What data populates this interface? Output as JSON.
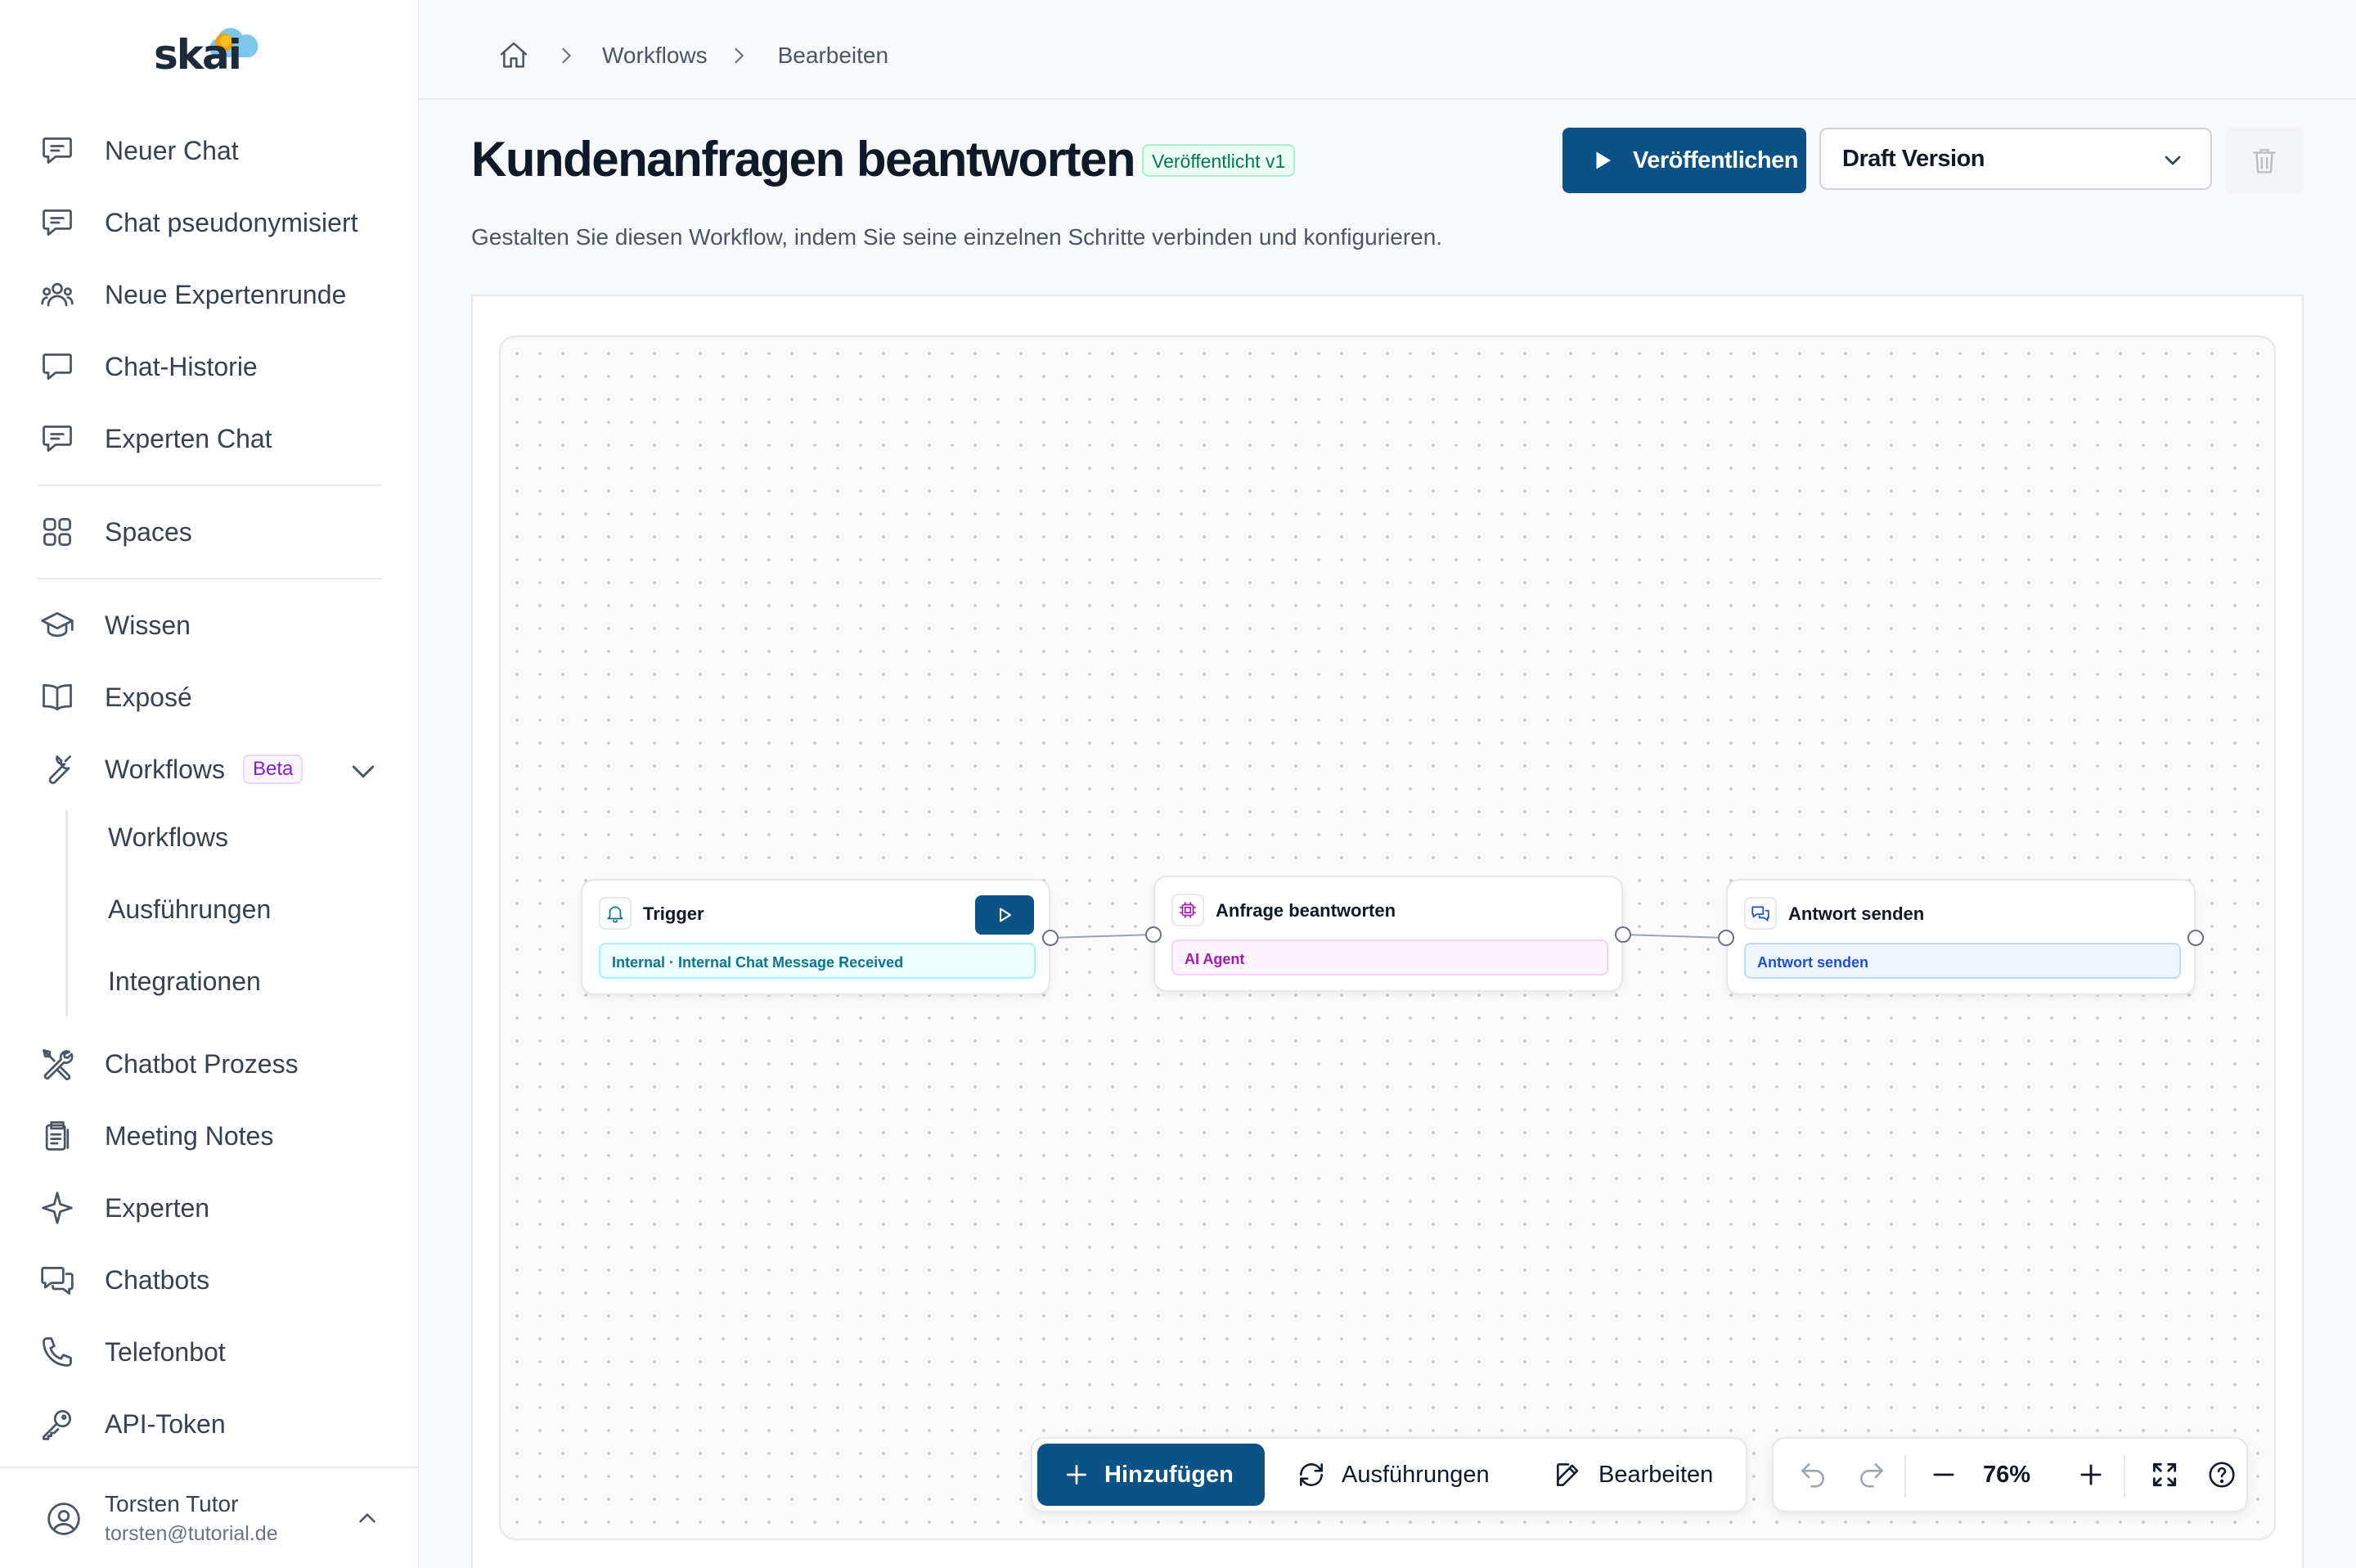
{
  "sidebar": {
    "logo": "skai",
    "items": [
      {
        "label": "Neuer Chat"
      },
      {
        "label": "Chat pseudonymisiert"
      },
      {
        "label": "Neue Expertenrunde"
      },
      {
        "label": "Chat-Historie"
      },
      {
        "label": "Experten Chat"
      },
      {
        "label": "Spaces"
      },
      {
        "label": "Wissen"
      },
      {
        "label": "Exposé"
      },
      {
        "label": "Workflows",
        "badge": "Beta",
        "expanded": true
      },
      {
        "label": "Chatbot Prozess"
      },
      {
        "label": "Meeting Notes"
      },
      {
        "label": "Experten"
      },
      {
        "label": "Chatbots"
      },
      {
        "label": "Telefonbot"
      },
      {
        "label": "API-Token"
      }
    ],
    "sub_items": [
      {
        "label": "Workflows"
      },
      {
        "label": "Ausführungen"
      },
      {
        "label": "Integrationen"
      }
    ],
    "user": {
      "name": "Torsten Tutor",
      "email": "torsten@tutorial.de"
    }
  },
  "breadcrumb": [
    "Workflows",
    "Bearbeiten"
  ],
  "header": {
    "title": "Kundenanfragen beantworten",
    "status_badge": "Veröffentlicht v1",
    "publish_label": "Veröffentlichen",
    "version_select": "Draft Version",
    "description": "Gestalten Sie diesen Workflow, indem Sie seine einzelnen Schritte verbinden und konfigurieren."
  },
  "nodes": [
    {
      "title": "Trigger",
      "tag": "Internal · Internal Chat Message Received",
      "icon": "bell-icon"
    },
    {
      "title": "Anfrage beantworten",
      "tag": "AI Agent",
      "icon": "cpu-icon"
    },
    {
      "title": "Antwort senden",
      "tag": "Antwort senden",
      "icon": "message-icon"
    }
  ],
  "toolbar": {
    "add_label": "Hinzufügen",
    "runs_label": "Ausführungen",
    "edit_label": "Bearbeiten",
    "zoom": "76%"
  },
  "colors": {
    "primary": "#0d5287",
    "published": "#047857",
    "trigger": "#0e7490",
    "agent": "#a21caf",
    "send": "#1d4ed8"
  }
}
